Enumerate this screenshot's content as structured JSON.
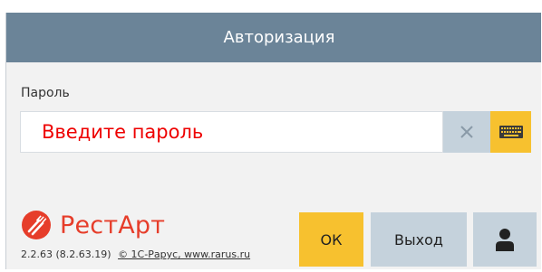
{
  "dialog": {
    "title": "Авторизация"
  },
  "password": {
    "label": "Пароль",
    "placeholder": "Введите пароль"
  },
  "icons": {
    "clear": "close-icon",
    "keyboard": "keyboard-icon",
    "user": "user-icon",
    "logo": "restart-logo-icon"
  },
  "brand": {
    "name": "РестАрт",
    "version": "2.2.63 (8.2.63.19)",
    "copyright": "© 1С-Рарус, www.rarus.ru"
  },
  "buttons": {
    "ok": "ОК",
    "exit": "Выход"
  },
  "colors": {
    "titlebar": "#6b8498",
    "accent_yellow": "#f7c12f",
    "secondary_blue": "#c5d2dc",
    "brand_red": "#e63d2a",
    "placeholder_red": "#ee0000"
  }
}
